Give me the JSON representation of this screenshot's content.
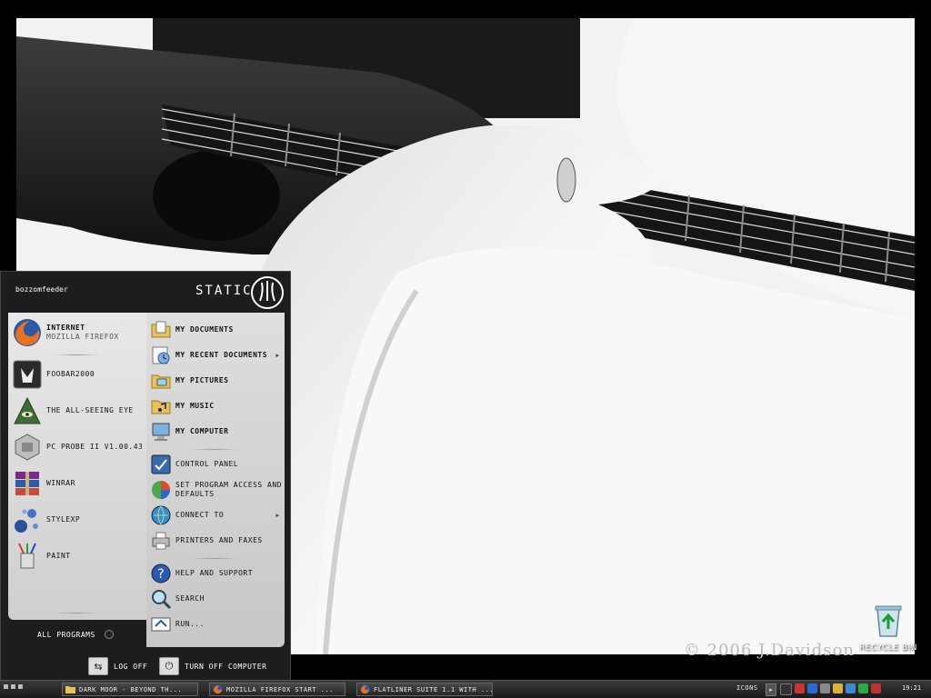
{
  "desktop": {
    "watermark": "© 2006 J.Davidson",
    "recycle_bin_label": "RECYCLE BIN"
  },
  "start_menu": {
    "username": "bozzomfeeder",
    "brand": "STATIC",
    "pinned": [
      {
        "label": "INTERNET",
        "sublabel": "MOZILLA FIREFOX",
        "icon": "firefox-icon"
      },
      {
        "label": "FOOBAR2000",
        "icon": "foobar-icon"
      }
    ],
    "recent": [
      {
        "label": "THE ALL-SEEING EYE",
        "icon": "eye-pyramid-icon"
      },
      {
        "label": "PC PROBE II V1.00.43",
        "icon": "pc-probe-icon"
      },
      {
        "label": "WINRAR",
        "icon": "winrar-icon"
      },
      {
        "label": "STYLEXP",
        "icon": "stylexp-icon"
      },
      {
        "label": "PAINT",
        "icon": "paint-icon"
      }
    ],
    "all_programs": "ALL PROGRAMS",
    "places": [
      {
        "label": "MY DOCUMENTS",
        "icon": "folder-documents-icon"
      },
      {
        "label": "MY RECENT DOCUMENTS",
        "icon": "recent-documents-icon",
        "has_submenu": true
      },
      {
        "label": "MY PICTURES",
        "icon": "folder-pictures-icon"
      },
      {
        "label": "MY MUSIC",
        "icon": "folder-music-icon"
      },
      {
        "label": "MY COMPUTER",
        "icon": "computer-icon"
      }
    ],
    "system": [
      {
        "label": "CONTROL PANEL",
        "icon": "control-panel-icon"
      },
      {
        "label": "SET PROGRAM ACCESS AND DEFAULTS",
        "icon": "program-defaults-icon"
      },
      {
        "label": "CONNECT TO",
        "icon": "connect-icon",
        "has_submenu": true
      },
      {
        "label": "PRINTERS AND FAXES",
        "icon": "printer-icon"
      }
    ],
    "help": [
      {
        "label": "HELP AND SUPPORT",
        "icon": "help-icon"
      },
      {
        "label": "SEARCH",
        "icon": "search-icon"
      },
      {
        "label": "RUN...",
        "icon": "run-icon"
      }
    ],
    "log_off": "LOG OFF",
    "turn_off": "TURN OFF COMPUTER"
  },
  "taskbar": {
    "tasks": [
      {
        "label": "DARK MOOR - BEYOND TH...",
        "icon": "folder-icon"
      },
      {
        "label": "MOZILLA FIREFOX START ...",
        "icon": "firefox-icon"
      },
      {
        "label": "FLATLINER SUITE 1.1 WITH ...",
        "icon": "firefox-icon"
      }
    ],
    "tray_label": "ICONS",
    "clock": "19:21"
  }
}
